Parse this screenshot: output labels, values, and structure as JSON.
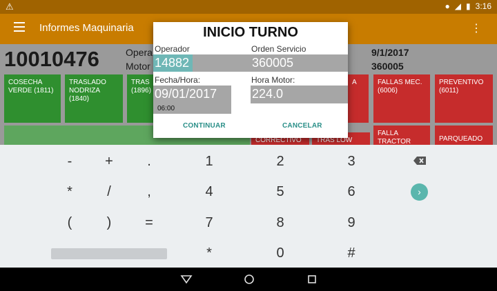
{
  "status_bar": {
    "time": "3:16"
  },
  "app_bar": {
    "title": "Informes Maquinaria"
  },
  "machine": {
    "id": "10010476",
    "operator_label": "Opera",
    "motor_label": "Motor",
    "date": "9/1/2017",
    "motor_value": "360005"
  },
  "tiles": {
    "cosecha": "COSECHA VERDE (1811)",
    "traslado": "TRASLADO NODRIZA (1840)",
    "tras": "TRAS (1896)",
    "partial_a": "A",
    "fallas": "FALLAS MEC. (6006)",
    "preventivo": "PREVENTIVO (6011)",
    "correctivo": "CORRECTIVO",
    "tras_low": "TRAS LOW",
    "falla_tractor": "FALLA TRACTOR",
    "parqueado": "PARQUEADO"
  },
  "dialog": {
    "title": "INICIO TURNO",
    "operador_label": "Operador",
    "operador_value": "14882",
    "orden_label": "Orden Servicio",
    "orden_value": "360005",
    "fecha_label": "Fecha/Hora:",
    "fecha_value": "09/01/2017",
    "hora_value": "06:00",
    "horamotor_label": "Hora Motor:",
    "horamotor_value": "224.0",
    "continuar": "CONTINUAR",
    "cancelar": "CANCELAR"
  },
  "keyboard": {
    "r1": [
      "-",
      "+",
      ".",
      "1",
      "2",
      "3"
    ],
    "r2": [
      "*",
      "/",
      ",",
      "4",
      "5",
      "6"
    ],
    "r3": [
      "(",
      ")",
      "=",
      "7",
      "8",
      "9"
    ],
    "r4": [
      "*",
      "0",
      "#"
    ]
  },
  "colors": {
    "app_bar": "#c87c00",
    "accent": "#6fb7b6",
    "tile_green": "#2f8f2f",
    "tile_red": "#c62c2c"
  }
}
